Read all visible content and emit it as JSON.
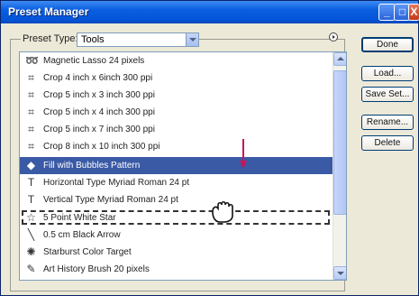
{
  "window": {
    "title": "Preset Manager"
  },
  "caption_buttons": {
    "minimize": "_",
    "maximize": "□",
    "close": "X"
  },
  "preset_type": {
    "label": "Preset Type:",
    "value": "Tools"
  },
  "list": {
    "items": [
      {
        "label": "Magnetic Lasso 24 pixels",
        "icon": "magnetic-lasso-icon",
        "selected": false
      },
      {
        "label": "Crop 4 inch x 6inch 300 ppi",
        "icon": "crop-icon",
        "selected": false
      },
      {
        "label": "Crop 5 inch x 3 inch 300 ppi",
        "icon": "crop-icon",
        "selected": false
      },
      {
        "label": "Crop 5 inch x 4 inch 300 ppi",
        "icon": "crop-icon",
        "selected": false
      },
      {
        "label": "Crop 5 inch x 7 inch 300 ppi",
        "icon": "crop-icon",
        "selected": false
      },
      {
        "label": "Crop 8 inch x 10 inch 300 ppi",
        "icon": "crop-icon",
        "selected": false
      },
      {
        "label": "Fill with Bubbles Pattern",
        "icon": "paint-bucket-icon",
        "selected": true
      },
      {
        "label": "Horizontal Type Myriad Roman 24 pt",
        "icon": "horizontal-type-icon",
        "selected": false
      },
      {
        "label": "Vertical Type Myriad Roman 24 pt",
        "icon": "vertical-type-icon",
        "selected": false
      },
      {
        "label": "5 Point White Star",
        "icon": "custom-shape-icon",
        "selected": false
      },
      {
        "label": "0.5 cm Black Arrow",
        "icon": "line-tool-icon",
        "selected": false
      },
      {
        "label": "Starburst Color Target",
        "icon": "starburst-icon",
        "selected": false
      },
      {
        "label": "Art History Brush 20 pixels",
        "icon": "art-history-brush-icon",
        "selected": false
      }
    ]
  },
  "buttons": {
    "done": "Done",
    "load": "Load...",
    "save_set": "Save Set...",
    "rename": "Rename...",
    "delete": "Delete"
  },
  "colors": {
    "selection": "#3a5aa6",
    "drag_arrow": "#c2185b"
  }
}
